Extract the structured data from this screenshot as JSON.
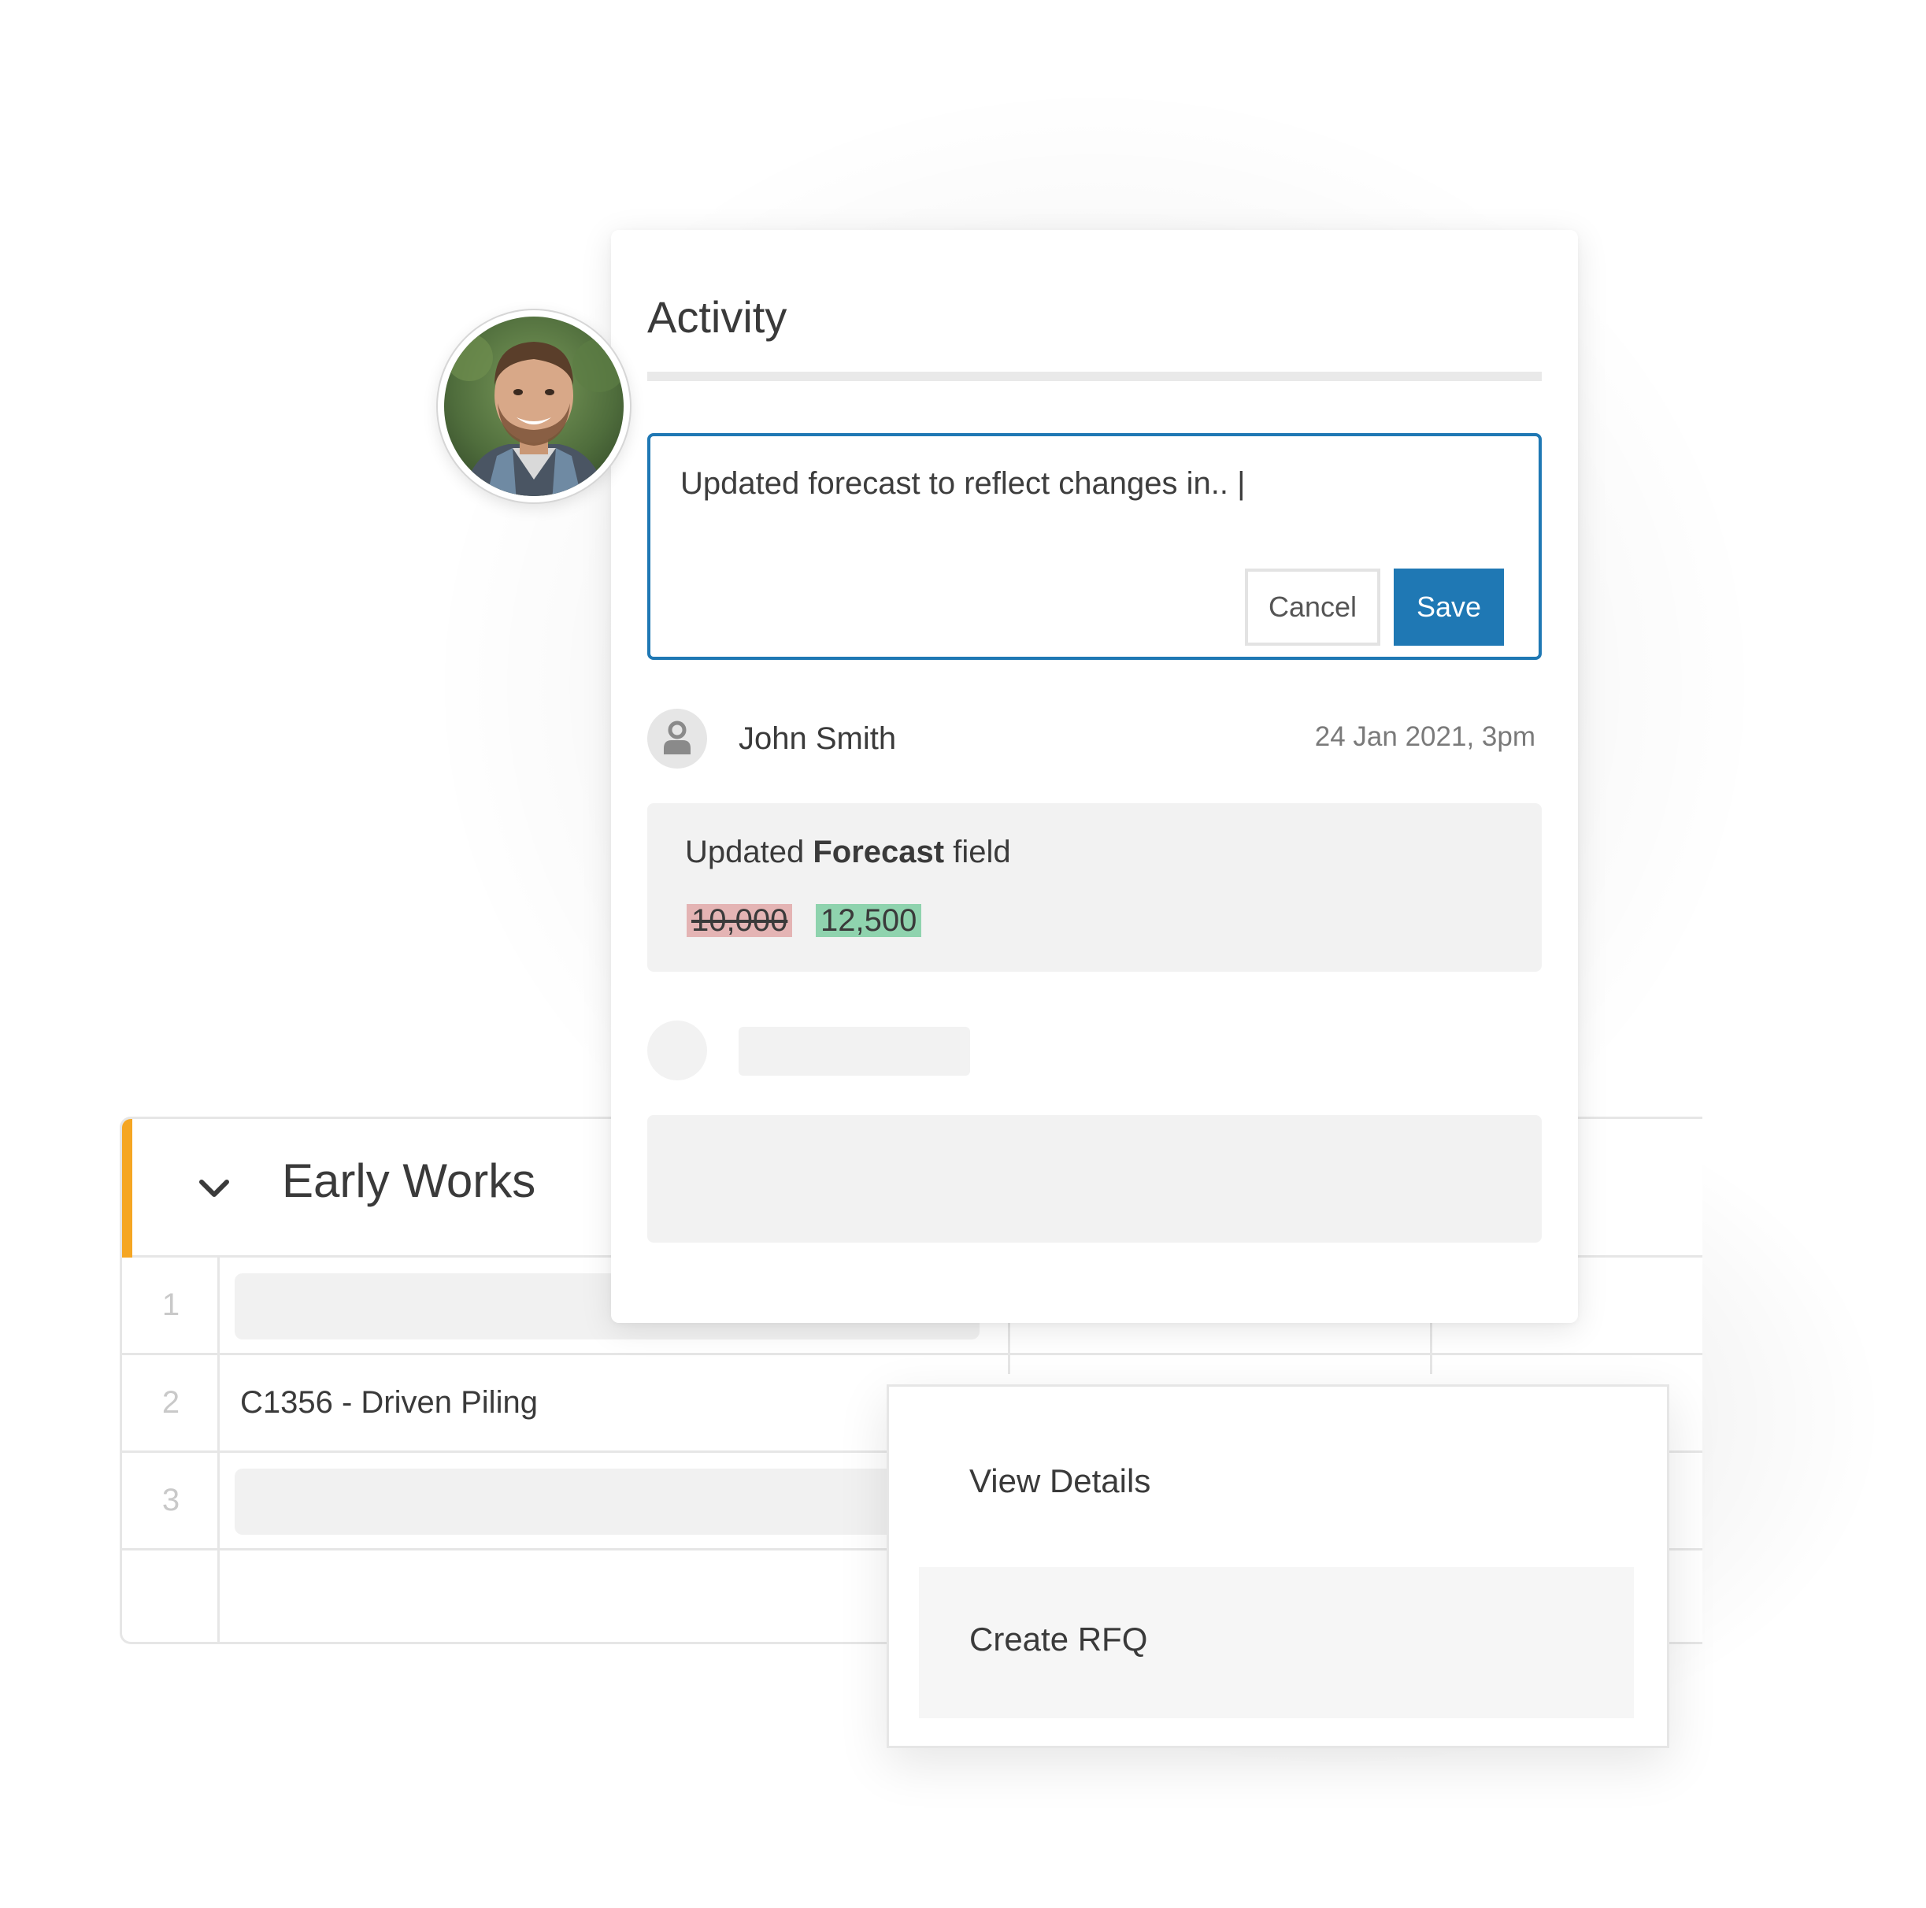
{
  "activity": {
    "title": "Activity",
    "comment": {
      "text": "Updated forecast to reflect changes in.. |",
      "cancel_label": "Cancel",
      "save_label": "Save"
    },
    "entry": {
      "user_name": "John Smith",
      "timestamp": "24 Jan 2021, 3pm",
      "change_prefix": "Updated ",
      "change_field": "Forecast",
      "change_suffix": " field",
      "old_value": "10,000",
      "new_value": "12,500"
    }
  },
  "table": {
    "group_title": "Early Works",
    "rows": [
      {
        "number": "1",
        "text": ""
      },
      {
        "number": "2",
        "text": "C1356 - Driven Piling"
      },
      {
        "number": "3",
        "text": ""
      }
    ]
  },
  "context_menu": {
    "items": [
      {
        "label": "View Details"
      },
      {
        "label": "Create RFQ"
      }
    ]
  },
  "colors": {
    "accent": "#f5a623",
    "primary": "#1f78b4",
    "removed": "#e4b4b4",
    "added": "#8fd3ae"
  },
  "icons": {
    "collapse": "chevron-down-icon",
    "user": "user-icon"
  }
}
